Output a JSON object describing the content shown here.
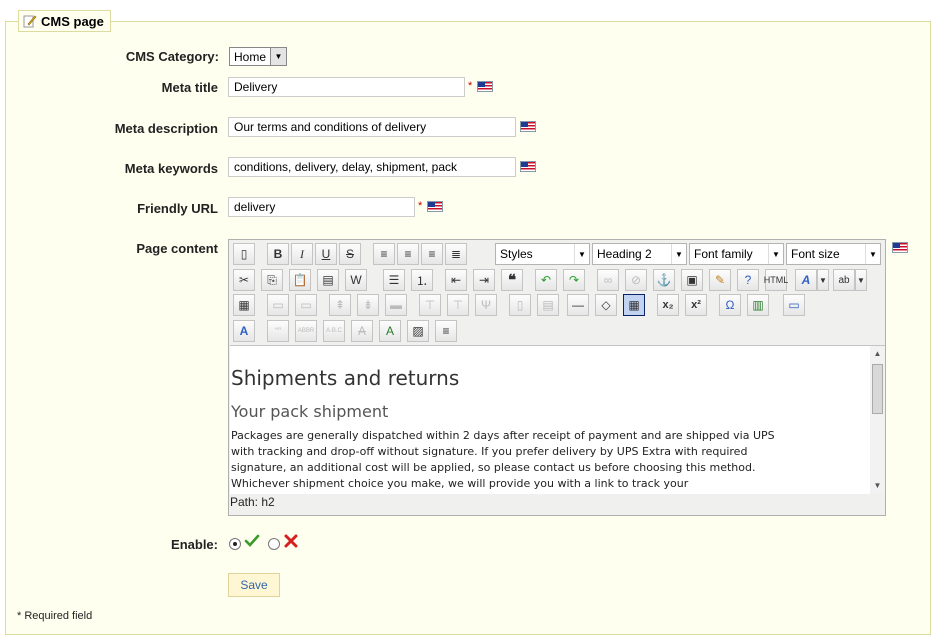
{
  "legend": {
    "title": "CMS page",
    "icon": "pencil-page-icon"
  },
  "fields": {
    "category": {
      "label": "CMS Category:",
      "value": "Home"
    },
    "meta_title": {
      "label": "Meta title",
      "value": "Delivery",
      "required": "*"
    },
    "meta_description": {
      "label": "Meta description",
      "value": "Our terms and conditions of delivery"
    },
    "meta_keywords": {
      "label": "Meta keywords",
      "value": "conditions, delivery, delay, shipment, pack"
    },
    "friendly_url": {
      "label": "Friendly URL",
      "value": "delivery",
      "required": "*"
    },
    "page_content": {
      "label": "Page content"
    }
  },
  "editor": {
    "dropdowns": {
      "styles": "Styles",
      "format": "Heading 2",
      "font_family": "Font family",
      "font_size": "Font size"
    },
    "content": {
      "heading": "Shipments and returns",
      "subheading": "Your pack shipment",
      "paragraph": "Packages are generally dispatched within 2 days after receipt of payment and are shipped via UPS with tracking and drop-off without signature. If you prefer delivery by UPS Extra with required signature, an additional cost will be applied, so please contact us before choosing this method. Whichever shipment choice you make, we will provide you with a link to track your"
    },
    "path": "Path: h2"
  },
  "enable": {
    "label": "Enable:",
    "selected": "yes"
  },
  "save_label": "Save",
  "footnote": "* Required field",
  "colors": {
    "panel_bg": "#fffff0",
    "panel_border": "#dcdca0",
    "required": "#cc0000",
    "save_bg": "#fff6d3"
  }
}
